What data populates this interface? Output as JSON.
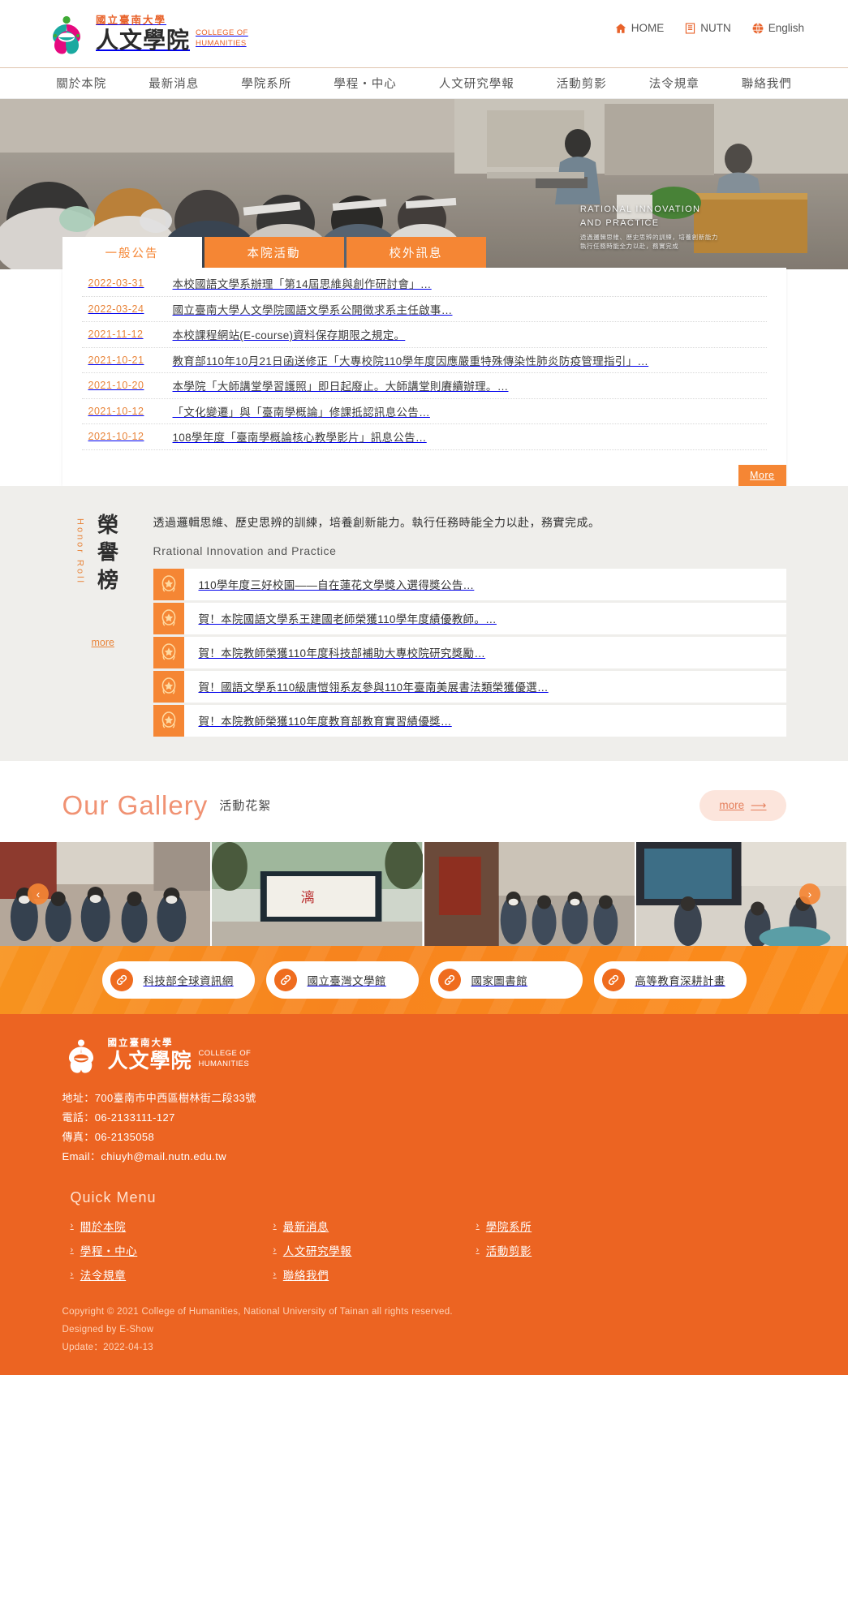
{
  "header": {
    "logo": {
      "univ_cn": "國立臺南大學",
      "college_cn": "人文學院",
      "en_line1": "COLLEGE OF",
      "en_line2": "HUMANITIES"
    },
    "links": [
      {
        "label": "HOME",
        "icon": "home-icon"
      },
      {
        "label": "NUTN",
        "icon": "building-icon"
      },
      {
        "label": "English",
        "icon": "globe-icon"
      }
    ]
  },
  "nav": {
    "items": [
      {
        "label": "關於本院"
      },
      {
        "label": "最新消息"
      },
      {
        "label": "學院系所"
      },
      {
        "label": "學程・中心"
      },
      {
        "label": "人文研究學報"
      },
      {
        "label": "活動剪影"
      },
      {
        "label": "法令規章"
      },
      {
        "label": "聯絡我們"
      }
    ]
  },
  "banner": {
    "caption_line1": "RATIONAL INNOVATION",
    "caption_line2": "AND PRACTICE",
    "sub_caption": "透過邏輯思維、歷史思辨的訓練，培養創新能力",
    "sub_caption2": "執行任務時能全力以赴，務實完成",
    "slide_count": 5,
    "active_slide": 2
  },
  "news": {
    "tabs": [
      {
        "label": "一般公告",
        "active": true
      },
      {
        "label": "本院活動",
        "active": false
      },
      {
        "label": "校外訊息",
        "active": false
      }
    ],
    "more_label": "More",
    "rows": [
      {
        "date": "2022-03-31",
        "title": "本校國語文學系辦理「第14屆思維與創作研討會」…"
      },
      {
        "date": "2022-03-24",
        "title": "國立臺南大學人文學院國語文學系公開徵求系主任啟事…"
      },
      {
        "date": "2021-11-12",
        "title": "本校課程網站(E-course)資料保存期限之規定。"
      },
      {
        "date": "2021-10-21",
        "title": "教育部110年10月21日函送修正「大專校院110學年度因應嚴重特殊傳染性肺炎防疫管理指引」…"
      },
      {
        "date": "2021-10-20",
        "title": "本學院「大師講堂學習護照」即日起廢止。大師講堂則賡續辦理。…"
      },
      {
        "date": "2021-10-12",
        "title": "「文化變遷」與「臺南學概論」修課抵認訊息公告…"
      },
      {
        "date": "2021-10-12",
        "title": "108學年度「臺南學概論核心教學影片」訊息公告…"
      }
    ]
  },
  "honor": {
    "title_cn": "榮譽榜",
    "title_en": "Honor Roll",
    "more_label": "more",
    "desc": "透過邏輯思維、歷史思辨的訓練，培養創新能力。執行任務時能全力以赴，務實完成。",
    "sub": "Rrational Innovation and Practice",
    "items": [
      {
        "title": "110學年度三好校園——自在蓮花文學獎入選得獎公告…",
        "icon": "medal-icon"
      },
      {
        "title": "賀！本院國語文學系王建國老師榮獲110學年度績優教師。…",
        "icon": "medal-icon"
      },
      {
        "title": "賀！本院教師榮獲110年度科技部補助大專校院研究獎勵…",
        "icon": "medal-icon"
      },
      {
        "title": "賀！國語文學系110級唐愷翎系友參與110年臺南美展書法類榮獲優選…",
        "icon": "medal-icon"
      },
      {
        "title": "賀！本院教師榮獲110年度教育部教育實習績優獎…",
        "icon": "medal-icon"
      }
    ]
  },
  "gallery": {
    "title_en": "Our Gallery",
    "title_cn": "活動花絮",
    "more_label": "more",
    "prev_label": "‹",
    "next_label": "›",
    "slides": 4
  },
  "linkbar": {
    "items": [
      {
        "label": "科技部全球資訊網",
        "icon": "link-icon"
      },
      {
        "label": "國立臺灣文學館",
        "icon": "link-icon"
      },
      {
        "label": "國家圖書館",
        "icon": "link-icon"
      },
      {
        "label": "高等教育深耕計畫",
        "icon": "link-icon"
      }
    ]
  },
  "footer": {
    "logo": {
      "univ_cn": "國立臺南大學",
      "college_cn": "人文學院",
      "en_line1": "COLLEGE OF",
      "en_line2": "HUMANITIES"
    },
    "address": "地址：700臺南市中西區樹林街二段33號",
    "phone": "電話：06-2133111-127",
    "fax": "傳真：06-2135058",
    "email": "Email：chiuyh@mail.nutn.edu.tw",
    "quick_menu_title": "Quick Menu",
    "quick_menu": [
      {
        "label": "關於本院"
      },
      {
        "label": "最新消息"
      },
      {
        "label": "學院系所"
      },
      {
        "label": "學程・中心"
      },
      {
        "label": "人文研究學報"
      },
      {
        "label": "活動剪影"
      },
      {
        "label": "法令規章"
      },
      {
        "label": "聯絡我們"
      }
    ],
    "copyright": "Copyright © 2021 College of Humanities, National University of Tainan all rights reserved.",
    "designed": "Designed by E-Show",
    "update": "Update：2022-04-13"
  },
  "colors": {
    "brand_orange": "#f58634",
    "footer_orange": "#ec6422",
    "accent_coral": "#f09273",
    "logo_teal": "#1aa9a0",
    "logo_magenta": "#e5097f",
    "logo_green": "#3faa35"
  }
}
